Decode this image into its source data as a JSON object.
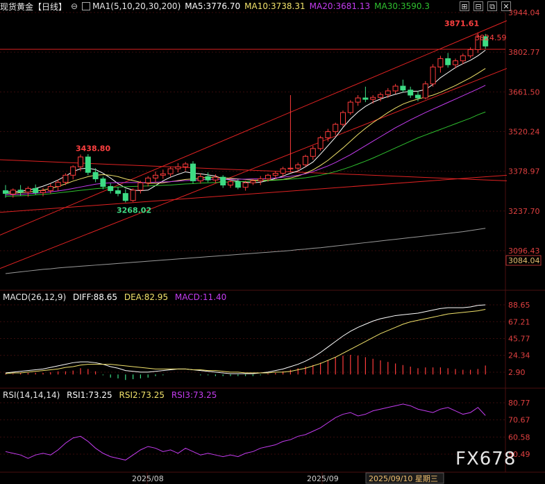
{
  "header": {
    "title": "现货黄金【日线】",
    "ma_label": "MA1(5,10,20,30,200)",
    "ma5": "MA5:3776.70",
    "ma10": "MA10:3738.31",
    "ma20": "MA20:3681.13",
    "ma30": "MA30:3590.3"
  },
  "macd_panel": {
    "label": "MACD(26,12,9)",
    "diff": "DIFF:88.65",
    "dea": "DEA:82.95",
    "macd": "MACD:11.40"
  },
  "rsi_panel": {
    "label": "RSI(14,14,14)",
    "rsi1": "RSI1:73.25",
    "rsi2": "RSI2:73.25",
    "rsi3": "RSI3:73.25"
  },
  "watermark": "FX678",
  "colors": {
    "up": "#ff3b3b",
    "down": "#3ddc84",
    "ma5": "#ffffff",
    "ma10": "#f2e36b",
    "ma20": "#c43cf0",
    "ma30": "#2fc12f",
    "ma200": "#9a9a9a",
    "grid": "#4a1010"
  },
  "chart_data": [
    {
      "type": "candlestick",
      "name": "main",
      "price_axis_ticks": [
        "3944.04",
        "3802.77",
        "3661.50",
        "3520.24",
        "3378.97",
        "3237.70",
        "3096.43"
      ],
      "ylim": [
        3050,
        3944.04
      ],
      "last_price_label": "3824.59",
      "extra_price_label": "3084.04",
      "annotations": {
        "high": "3871.61",
        "earlier_high": "3438.80",
        "low": "3268.02"
      },
      "candles": [
        [
          3310,
          3330,
          3285,
          3300
        ],
        [
          3298,
          3318,
          3285,
          3312
        ],
        [
          3312,
          3330,
          3292,
          3305
        ],
        [
          3305,
          3325,
          3288,
          3318
        ],
        [
          3318,
          3332,
          3296,
          3303
        ],
        [
          3303,
          3320,
          3290,
          3310
        ],
        [
          3310,
          3335,
          3300,
          3325
        ],
        [
          3325,
          3350,
          3310,
          3340
        ],
        [
          3340,
          3372,
          3330,
          3365
        ],
        [
          3365,
          3400,
          3350,
          3395
        ],
        [
          3395,
          3438.8,
          3380,
          3430
        ],
        [
          3430,
          3440,
          3365,
          3375
        ],
        [
          3375,
          3390,
          3340,
          3352
        ],
        [
          3352,
          3360,
          3315,
          3325
        ],
        [
          3325,
          3336,
          3300,
          3310
        ],
        [
          3310,
          3322,
          3290,
          3300
        ],
        [
          3300,
          3315,
          3268.02,
          3275
        ],
        [
          3275,
          3318,
          3270,
          3312
        ],
        [
          3312,
          3345,
          3300,
          3338
        ],
        [
          3338,
          3362,
          3325,
          3355
        ],
        [
          3355,
          3378,
          3340,
          3365
        ],
        [
          3365,
          3385,
          3352,
          3370
        ],
        [
          3370,
          3395,
          3360,
          3388
        ],
        [
          3388,
          3408,
          3375,
          3395
        ],
        [
          3395,
          3412,
          3380,
          3405
        ],
        [
          3405,
          3415,
          3335,
          3345
        ],
        [
          3345,
          3372,
          3335,
          3360
        ],
        [
          3360,
          3375,
          3340,
          3348
        ],
        [
          3348,
          3368,
          3338,
          3358
        ],
        [
          3358,
          3365,
          3320,
          3330
        ],
        [
          3330,
          3350,
          3320,
          3342
        ],
        [
          3342,
          3350,
          3315,
          3322
        ],
        [
          3322,
          3345,
          3310,
          3338
        ],
        [
          3338,
          3352,
          3330,
          3345
        ],
        [
          3345,
          3362,
          3330,
          3352
        ],
        [
          3352,
          3370,
          3342,
          3365
        ],
        [
          3365,
          3380,
          3352,
          3372
        ],
        [
          3372,
          3395,
          3360,
          3388
        ],
        [
          3388,
          3650,
          3375,
          3390
        ],
        [
          3390,
          3410,
          3380,
          3402
        ],
        [
          3402,
          3438,
          3395,
          3432
        ],
        [
          3432,
          3470,
          3420,
          3460
        ],
        [
          3460,
          3505,
          3452,
          3498
        ],
        [
          3498,
          3530,
          3485,
          3520
        ],
        [
          3520,
          3552,
          3508,
          3546
        ],
        [
          3546,
          3595,
          3538,
          3588
        ],
        [
          3588,
          3632,
          3580,
          3625
        ],
        [
          3625,
          3650,
          3612,
          3640
        ],
        [
          3640,
          3680,
          3625,
          3635
        ],
        [
          3635,
          3650,
          3620,
          3642
        ],
        [
          3642,
          3660,
          3628,
          3652
        ],
        [
          3652,
          3675,
          3640,
          3665
        ],
        [
          3665,
          3690,
          3655,
          3682
        ],
        [
          3682,
          3705,
          3660,
          3668
        ],
        [
          3668,
          3680,
          3640,
          3650
        ],
        [
          3650,
          3665,
          3628,
          3640
        ],
        [
          3640,
          3700,
          3635,
          3690
        ],
        [
          3690,
          3760,
          3680,
          3750
        ],
        [
          3750,
          3790,
          3730,
          3780
        ],
        [
          3780,
          3800,
          3748,
          3758
        ],
        [
          3758,
          3780,
          3745,
          3772
        ],
        [
          3772,
          3798,
          3760,
          3790
        ],
        [
          3790,
          3820,
          3782,
          3812
        ],
        [
          3812,
          3871.61,
          3800,
          3858
        ],
        [
          3858,
          3868,
          3815,
          3824.59
        ]
      ],
      "moving_averages": {
        "MA5": [
          3305,
          3306,
          3308,
          3312,
          3318,
          3326,
          3336,
          3348,
          3362,
          3378,
          3388,
          3390,
          3385,
          3372,
          3355,
          3335,
          3320,
          3312,
          3310,
          3312,
          3328,
          3345,
          3358,
          3368,
          3377,
          3372,
          3370,
          3366,
          3362,
          3352,
          3348,
          3344,
          3340,
          3338,
          3340,
          3346,
          3353,
          3362,
          3372,
          3380,
          3395,
          3412,
          3440,
          3470,
          3500,
          3535,
          3565,
          3590,
          3610,
          3625,
          3636,
          3645,
          3653,
          3660,
          3664,
          3664,
          3670,
          3688,
          3712,
          3730,
          3748,
          3762,
          3774,
          3790,
          3810
        ],
        "MA10": [
          3300,
          3301,
          3303,
          3305,
          3308,
          3312,
          3318,
          3325,
          3334,
          3344,
          3352,
          3360,
          3365,
          3367,
          3365,
          3360,
          3352,
          3346,
          3340,
          3336,
          3336,
          3338,
          3342,
          3346,
          3350,
          3352,
          3355,
          3357,
          3358,
          3356,
          3354,
          3352,
          3350,
          3348,
          3347,
          3347,
          3348,
          3350,
          3355,
          3362,
          3372,
          3384,
          3400,
          3418,
          3440,
          3462,
          3486,
          3510,
          3532,
          3552,
          3570,
          3588,
          3604,
          3618,
          3628,
          3636,
          3643,
          3650,
          3660,
          3672,
          3684,
          3698,
          3712,
          3728,
          3745
        ],
        "MA20": [
          3295,
          3296,
          3297,
          3299,
          3301,
          3303,
          3306,
          3309,
          3313,
          3318,
          3323,
          3328,
          3333,
          3336,
          3338,
          3339,
          3339,
          3339,
          3339,
          3339,
          3340,
          3341,
          3342,
          3344,
          3346,
          3347,
          3349,
          3350,
          3351,
          3351,
          3351,
          3351,
          3351,
          3352,
          3352,
          3353,
          3355,
          3358,
          3361,
          3365,
          3370,
          3378,
          3388,
          3398,
          3410,
          3424,
          3438,
          3454,
          3470,
          3486,
          3502,
          3518,
          3534,
          3548,
          3562,
          3575,
          3588,
          3600,
          3612,
          3624,
          3636,
          3648,
          3660,
          3672,
          3685
        ],
        "MA30": [
          3290,
          3291,
          3292,
          3293,
          3295,
          3297,
          3299,
          3302,
          3305,
          3308,
          3311,
          3314,
          3317,
          3319,
          3321,
          3323,
          3324,
          3325,
          3326,
          3327,
          3328,
          3329,
          3330,
          3332,
          3334,
          3335,
          3337,
          3338,
          3339,
          3340,
          3341,
          3342,
          3343,
          3344,
          3345,
          3346,
          3347,
          3349,
          3351,
          3353,
          3356,
          3360,
          3365,
          3371,
          3378,
          3386,
          3395,
          3405,
          3415,
          3426,
          3438,
          3450,
          3462,
          3474,
          3486,
          3498,
          3508,
          3518,
          3528,
          3538,
          3548,
          3558,
          3568,
          3580,
          3590
        ],
        "MA200": [
          3015,
          3018,
          3021,
          3024,
          3027,
          3030,
          3032,
          3035,
          3037,
          3039,
          3041,
          3043,
          3045,
          3047,
          3049,
          3051,
          3053,
          3055,
          3057,
          3059,
          3061,
          3063,
          3065,
          3067,
          3069,
          3071,
          3073,
          3075,
          3077,
          3079,
          3081,
          3083,
          3085,
          3087,
          3089,
          3091,
          3093,
          3095,
          3097,
          3100,
          3102,
          3105,
          3107,
          3110,
          3113,
          3116,
          3119,
          3122,
          3125,
          3128,
          3131,
          3134,
          3137,
          3140,
          3143,
          3146,
          3149,
          3152,
          3155,
          3158,
          3161,
          3164,
          3168,
          3172,
          3176
        ]
      }
    },
    {
      "type": "macd",
      "name": "macd",
      "axis_ticks": [
        "88.65",
        "67.21",
        "45.77",
        "24.34",
        "2.90"
      ],
      "ylim": [
        -6,
        95
      ],
      "diff": [
        2,
        3,
        4,
        5,
        6,
        7,
        9,
        11,
        13,
        15,
        16,
        16,
        15,
        13,
        10,
        8,
        5,
        4,
        3,
        3,
        4,
        5,
        6,
        7,
        7,
        6,
        5,
        4,
        3,
        2,
        1,
        1,
        1,
        1,
        2,
        3,
        5,
        7,
        10,
        13,
        17,
        22,
        28,
        35,
        42,
        49,
        55,
        60,
        64,
        68,
        71,
        73,
        75,
        76,
        77,
        78,
        80,
        82,
        84,
        85,
        85,
        85,
        86,
        88,
        88.65
      ],
      "dea": [
        1,
        2,
        2,
        3,
        4,
        5,
        6,
        7,
        9,
        10,
        12,
        13,
        13,
        13,
        13,
        12,
        11,
        10,
        9,
        8,
        7,
        7,
        7,
        7,
        7,
        6,
        6,
        5,
        5,
        4,
        3,
        3,
        2,
        2,
        2,
        2,
        3,
        3,
        4,
        6,
        8,
        11,
        14,
        18,
        22,
        27,
        32,
        37,
        42,
        47,
        52,
        56,
        60,
        64,
        67,
        69,
        71,
        73,
        75,
        77,
        78,
        79,
        80,
        81,
        82.95
      ],
      "hist": [
        1,
        1,
        2,
        2,
        2,
        2,
        3,
        4,
        4,
        5,
        8,
        7,
        4,
        -1,
        -4,
        -5,
        -7,
        -6,
        -5,
        -4,
        -2,
        -1,
        0,
        0,
        0,
        0,
        -1,
        -1,
        -2,
        -2,
        -2,
        -2,
        -2,
        -2,
        -1,
        1,
        2,
        4,
        6,
        8,
        10,
        12,
        15,
        18,
        22,
        24,
        25,
        24,
        22,
        20,
        18,
        16,
        14,
        12,
        10,
        8,
        9,
        9,
        9,
        8,
        7,
        6,
        6,
        7,
        11.4
      ]
    },
    {
      "type": "line",
      "name": "rsi",
      "axis_ticks": [
        "80.77",
        "70.67",
        "60.58",
        "50.49"
      ],
      "ylim": [
        45,
        85
      ],
      "values": [
        52,
        51,
        50,
        48,
        50,
        51,
        50,
        53,
        57,
        60,
        61,
        58,
        54,
        51,
        49,
        48,
        47,
        50,
        53,
        55,
        54,
        52,
        53,
        51,
        54,
        52,
        50,
        51,
        50,
        49,
        50,
        49,
        51,
        52,
        54,
        55,
        56,
        58,
        59,
        61,
        62,
        64,
        66,
        69,
        72,
        74,
        75,
        73,
        74,
        76,
        77,
        78,
        79,
        80,
        79,
        77,
        76,
        75,
        77,
        78,
        76,
        74,
        75,
        78,
        73.25
      ]
    }
  ],
  "x_axis_labels": [
    "2025/08",
    "2025/09",
    "2025/09/10 星期三"
  ]
}
